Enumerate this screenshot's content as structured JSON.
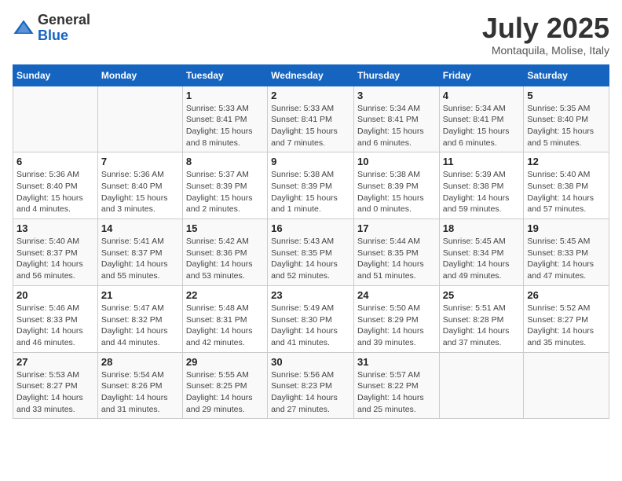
{
  "logo": {
    "general": "General",
    "blue": "Blue"
  },
  "title": "July 2025",
  "location": "Montaquila, Molise, Italy",
  "weekdays": [
    "Sunday",
    "Monday",
    "Tuesday",
    "Wednesday",
    "Thursday",
    "Friday",
    "Saturday"
  ],
  "weeks": [
    [
      {
        "day": "",
        "info": ""
      },
      {
        "day": "",
        "info": ""
      },
      {
        "day": "1",
        "info": "Sunrise: 5:33 AM\nSunset: 8:41 PM\nDaylight: 15 hours\nand 8 minutes."
      },
      {
        "day": "2",
        "info": "Sunrise: 5:33 AM\nSunset: 8:41 PM\nDaylight: 15 hours\nand 7 minutes."
      },
      {
        "day": "3",
        "info": "Sunrise: 5:34 AM\nSunset: 8:41 PM\nDaylight: 15 hours\nand 6 minutes."
      },
      {
        "day": "4",
        "info": "Sunrise: 5:34 AM\nSunset: 8:41 PM\nDaylight: 15 hours\nand 6 minutes."
      },
      {
        "day": "5",
        "info": "Sunrise: 5:35 AM\nSunset: 8:40 PM\nDaylight: 15 hours\nand 5 minutes."
      }
    ],
    [
      {
        "day": "6",
        "info": "Sunrise: 5:36 AM\nSunset: 8:40 PM\nDaylight: 15 hours\nand 4 minutes."
      },
      {
        "day": "7",
        "info": "Sunrise: 5:36 AM\nSunset: 8:40 PM\nDaylight: 15 hours\nand 3 minutes."
      },
      {
        "day": "8",
        "info": "Sunrise: 5:37 AM\nSunset: 8:39 PM\nDaylight: 15 hours\nand 2 minutes."
      },
      {
        "day": "9",
        "info": "Sunrise: 5:38 AM\nSunset: 8:39 PM\nDaylight: 15 hours\nand 1 minute."
      },
      {
        "day": "10",
        "info": "Sunrise: 5:38 AM\nSunset: 8:39 PM\nDaylight: 15 hours\nand 0 minutes."
      },
      {
        "day": "11",
        "info": "Sunrise: 5:39 AM\nSunset: 8:38 PM\nDaylight: 14 hours\nand 59 minutes."
      },
      {
        "day": "12",
        "info": "Sunrise: 5:40 AM\nSunset: 8:38 PM\nDaylight: 14 hours\nand 57 minutes."
      }
    ],
    [
      {
        "day": "13",
        "info": "Sunrise: 5:40 AM\nSunset: 8:37 PM\nDaylight: 14 hours\nand 56 minutes."
      },
      {
        "day": "14",
        "info": "Sunrise: 5:41 AM\nSunset: 8:37 PM\nDaylight: 14 hours\nand 55 minutes."
      },
      {
        "day": "15",
        "info": "Sunrise: 5:42 AM\nSunset: 8:36 PM\nDaylight: 14 hours\nand 53 minutes."
      },
      {
        "day": "16",
        "info": "Sunrise: 5:43 AM\nSunset: 8:35 PM\nDaylight: 14 hours\nand 52 minutes."
      },
      {
        "day": "17",
        "info": "Sunrise: 5:44 AM\nSunset: 8:35 PM\nDaylight: 14 hours\nand 51 minutes."
      },
      {
        "day": "18",
        "info": "Sunrise: 5:45 AM\nSunset: 8:34 PM\nDaylight: 14 hours\nand 49 minutes."
      },
      {
        "day": "19",
        "info": "Sunrise: 5:45 AM\nSunset: 8:33 PM\nDaylight: 14 hours\nand 47 minutes."
      }
    ],
    [
      {
        "day": "20",
        "info": "Sunrise: 5:46 AM\nSunset: 8:33 PM\nDaylight: 14 hours\nand 46 minutes."
      },
      {
        "day": "21",
        "info": "Sunrise: 5:47 AM\nSunset: 8:32 PM\nDaylight: 14 hours\nand 44 minutes."
      },
      {
        "day": "22",
        "info": "Sunrise: 5:48 AM\nSunset: 8:31 PM\nDaylight: 14 hours\nand 42 minutes."
      },
      {
        "day": "23",
        "info": "Sunrise: 5:49 AM\nSunset: 8:30 PM\nDaylight: 14 hours\nand 41 minutes."
      },
      {
        "day": "24",
        "info": "Sunrise: 5:50 AM\nSunset: 8:29 PM\nDaylight: 14 hours\nand 39 minutes."
      },
      {
        "day": "25",
        "info": "Sunrise: 5:51 AM\nSunset: 8:28 PM\nDaylight: 14 hours\nand 37 minutes."
      },
      {
        "day": "26",
        "info": "Sunrise: 5:52 AM\nSunset: 8:27 PM\nDaylight: 14 hours\nand 35 minutes."
      }
    ],
    [
      {
        "day": "27",
        "info": "Sunrise: 5:53 AM\nSunset: 8:27 PM\nDaylight: 14 hours\nand 33 minutes."
      },
      {
        "day": "28",
        "info": "Sunrise: 5:54 AM\nSunset: 8:26 PM\nDaylight: 14 hours\nand 31 minutes."
      },
      {
        "day": "29",
        "info": "Sunrise: 5:55 AM\nSunset: 8:25 PM\nDaylight: 14 hours\nand 29 minutes."
      },
      {
        "day": "30",
        "info": "Sunrise: 5:56 AM\nSunset: 8:23 PM\nDaylight: 14 hours\nand 27 minutes."
      },
      {
        "day": "31",
        "info": "Sunrise: 5:57 AM\nSunset: 8:22 PM\nDaylight: 14 hours\nand 25 minutes."
      },
      {
        "day": "",
        "info": ""
      },
      {
        "day": "",
        "info": ""
      }
    ]
  ]
}
